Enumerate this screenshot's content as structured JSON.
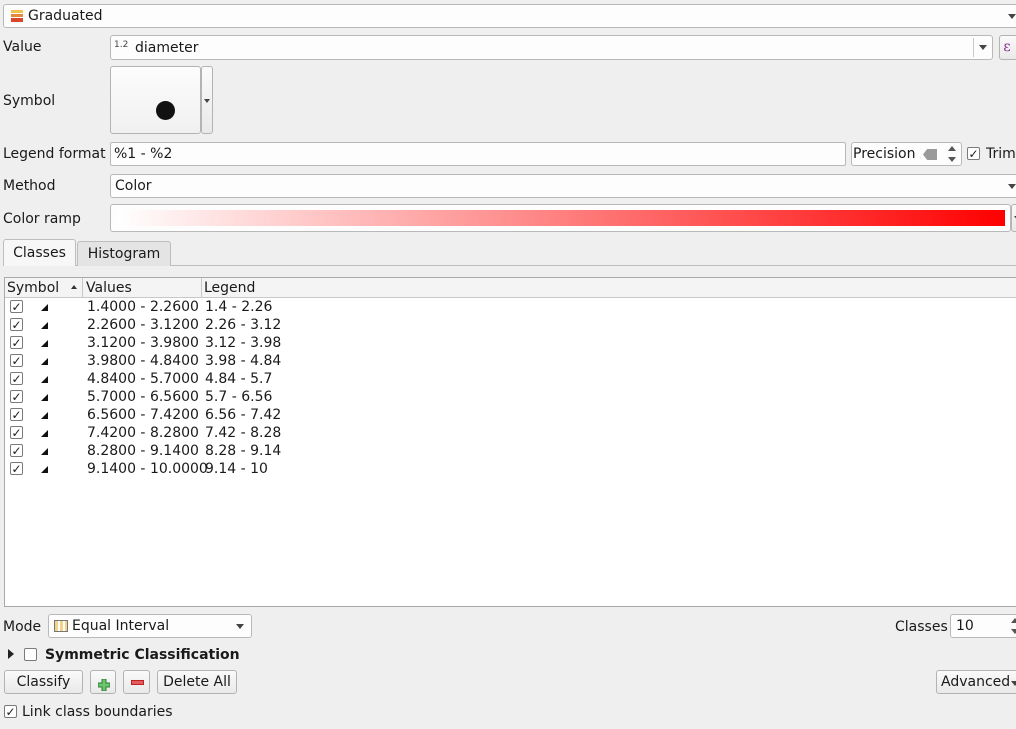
{
  "renderer": {
    "label": "Graduated",
    "icon": "graduated-renderer-icon"
  },
  "value": {
    "label": "Value",
    "type_badge": "1.2",
    "field": "diameter",
    "expression_glyph": "ε"
  },
  "symbol": {
    "label": "Symbol"
  },
  "legend_format": {
    "label": "Legend format",
    "value": "%1 - %2",
    "precision": "Precision 2",
    "trim_label": "Trim",
    "trim_checked": true
  },
  "method": {
    "label": "Method",
    "value": "Color"
  },
  "color_ramp": {
    "label": "Color ramp",
    "start_color": "#ffffff",
    "end_color": "#ff0000"
  },
  "tabs": [
    {
      "label": "Classes",
      "active": true
    },
    {
      "label": "Histogram",
      "active": false
    }
  ],
  "table": {
    "headers": {
      "symbol": "Symbol",
      "values": "Values",
      "legend": "Legend"
    },
    "rows": [
      {
        "checked": true,
        "values": "1.4000 - 2.2600",
        "legend": "1.4 - 2.26"
      },
      {
        "checked": true,
        "values": "2.2600 - 3.1200",
        "legend": "2.26 - 3.12"
      },
      {
        "checked": true,
        "values": "3.1200 - 3.9800",
        "legend": "3.12 - 3.98"
      },
      {
        "checked": true,
        "values": "3.9800 - 4.8400",
        "legend": "3.98 - 4.84"
      },
      {
        "checked": true,
        "values": "4.8400 - 5.7000",
        "legend": "4.84 - 5.7"
      },
      {
        "checked": true,
        "values": "5.7000 - 6.5600",
        "legend": "5.7 - 6.56"
      },
      {
        "checked": true,
        "values": "6.5600 - 7.4200",
        "legend": "6.56 - 7.42"
      },
      {
        "checked": true,
        "values": "7.4200 - 8.2800",
        "legend": "7.42 - 8.28"
      },
      {
        "checked": true,
        "values": "8.2800 - 9.1400",
        "legend": "8.28 - 9.14"
      },
      {
        "checked": true,
        "values": "9.1400 - 10.0000",
        "legend": "9.14 - 10"
      }
    ]
  },
  "mode": {
    "label": "Mode",
    "value": "Equal Interval"
  },
  "classes": {
    "label": "Classes",
    "value": "10"
  },
  "symmetric": {
    "label": "Symmetric Classification",
    "checked": false
  },
  "buttons": {
    "classify": "Classify",
    "delete_all": "Delete All",
    "advanced": "Advanced"
  },
  "link_boundaries": {
    "label": "Link class boundaries",
    "checked": true
  }
}
